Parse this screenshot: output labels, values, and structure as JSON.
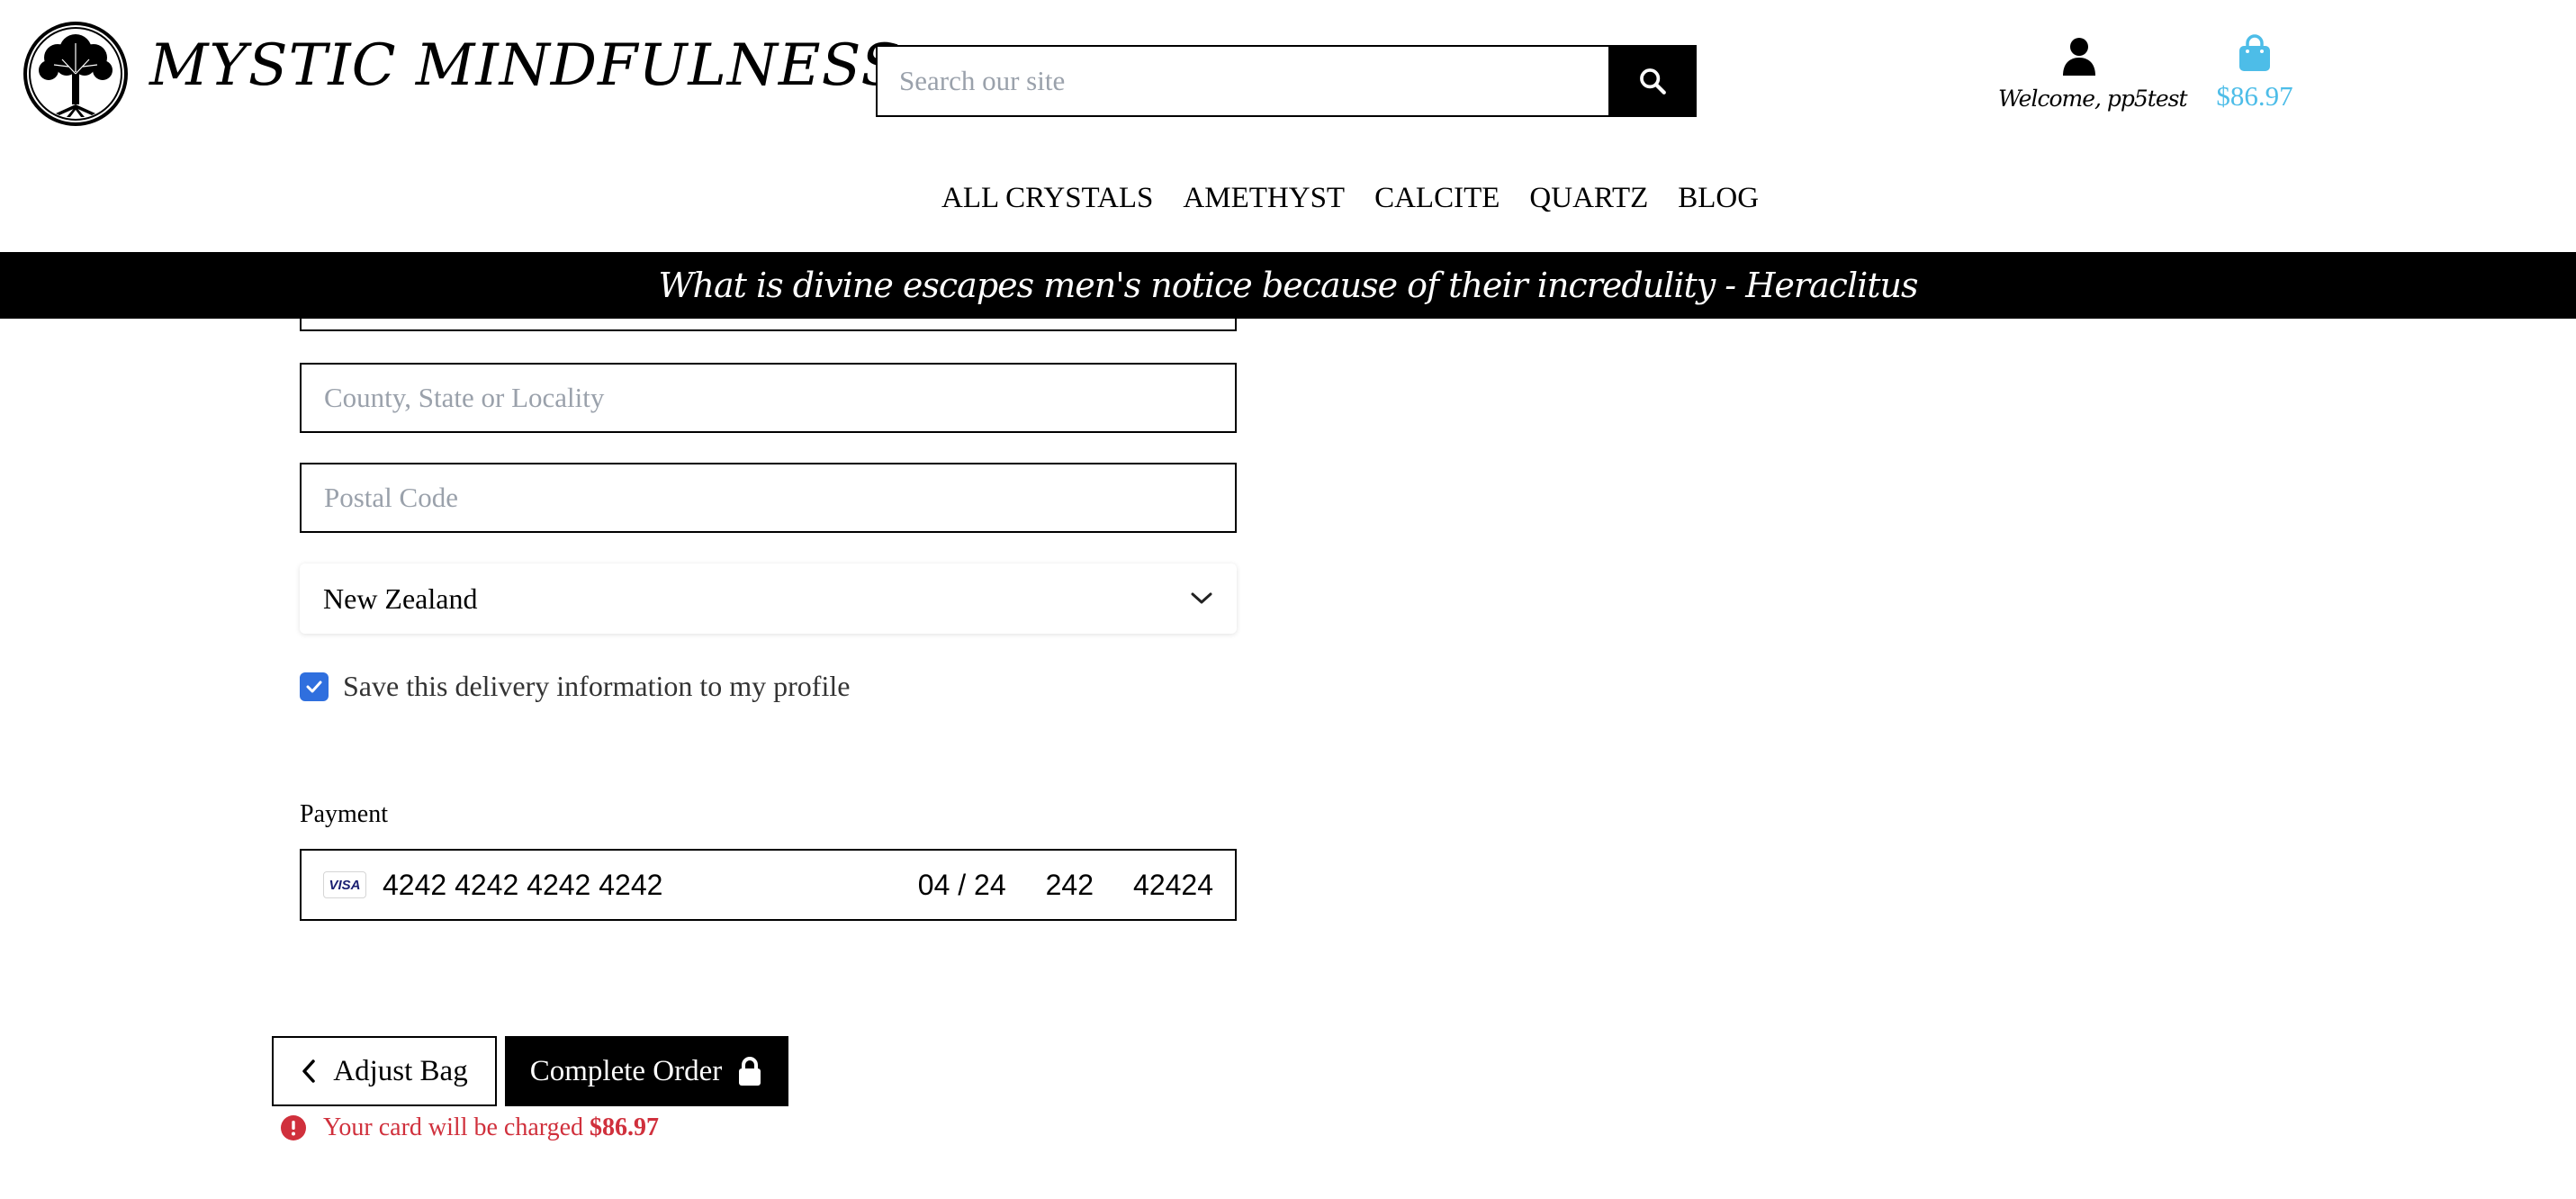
{
  "header": {
    "brand": "MYSTIC MINDFULNESS",
    "search_placeholder": "Search our site",
    "welcome": "Welcome, pp5test",
    "bag_total": "$86.97"
  },
  "nav": {
    "items": [
      "ALL CRYSTALS",
      "AMETHYST",
      "CALCITE",
      "QUARTZ",
      "BLOG"
    ]
  },
  "quote": "What is divine escapes men's notice because of their incredulity - Heraclitus",
  "form": {
    "county_placeholder": "County, State or Locality",
    "postal_placeholder": "Postal Code",
    "country": "New Zealand",
    "save_label": "Save this delivery information to my profile",
    "save_checked": true
  },
  "payment": {
    "label": "Payment",
    "card_brand": "VISA",
    "card_number": "4242 4242 4242 4242",
    "expiry": "04 / 24",
    "cvc": "242",
    "postal": "42424"
  },
  "actions": {
    "adjust_label": "Adjust Bag",
    "complete_label": "Complete Order",
    "charge_text": "Your card will be charged",
    "charge_amount": "$86.97"
  },
  "colors": {
    "accent_bag": "#4dbde8",
    "checkbox": "#2f6fde",
    "error": "#d0303c"
  },
  "icons": [
    "tree-logo-icon",
    "search-icon",
    "user-icon",
    "shopping-bag-icon",
    "chevron-down-icon",
    "checkmark-icon",
    "chevron-left-icon",
    "lock-icon",
    "alert-icon"
  ]
}
